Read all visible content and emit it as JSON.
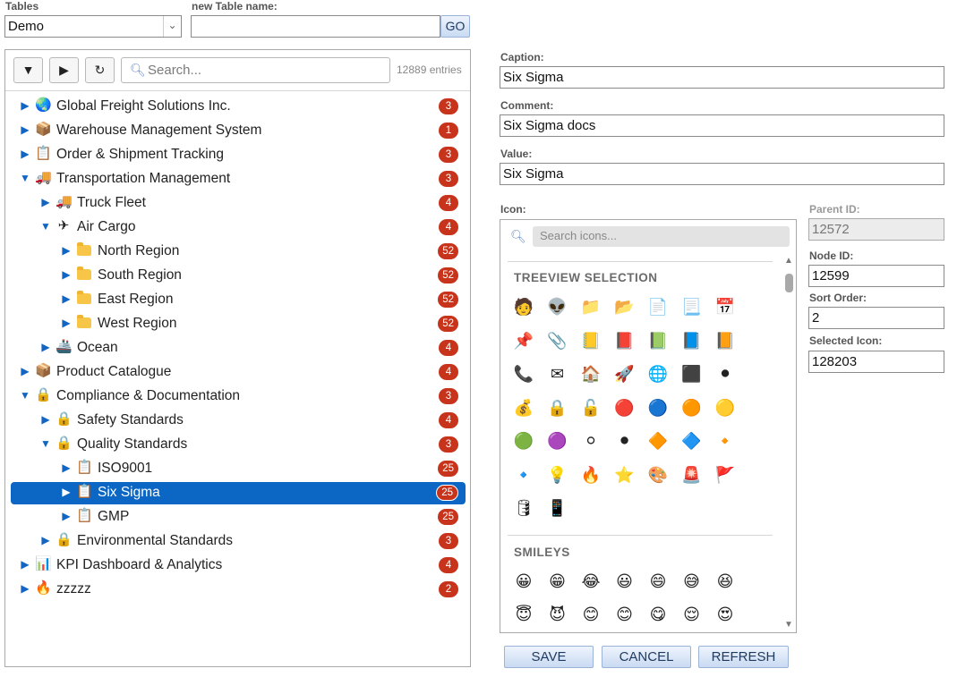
{
  "top": {
    "tables_label": "Tables",
    "tables_value": "Demo",
    "new_table_label": "new Table name:",
    "new_table_value": "",
    "go_label": "GO"
  },
  "tree": {
    "toolbar": {
      "collapse_icon": "▼",
      "expand_icon": "▶",
      "refresh_icon": "↻"
    },
    "search_placeholder": "Search...",
    "entries": "12889 entries",
    "rows": [
      {
        "label": "Global Freight Solutions Inc.",
        "icon": "🌏",
        "count": "3",
        "expanded": false
      },
      {
        "label": "Warehouse Management System",
        "icon": "📦",
        "count": "1",
        "expanded": false
      },
      {
        "label": "Order & Shipment Tracking",
        "icon": "📋",
        "count": "3",
        "expanded": false
      },
      {
        "label": "Transportation Management",
        "icon": "🚚",
        "count": "3",
        "expanded": true
      },
      {
        "label": "Truck Fleet",
        "icon": "🚚",
        "count": "4",
        "expanded": false
      },
      {
        "label": "Air Cargo",
        "icon": "✈",
        "count": "4",
        "expanded": true
      },
      {
        "label": "North Region",
        "icon": "folder",
        "count": "52",
        "expanded": false
      },
      {
        "label": "South Region",
        "icon": "folder",
        "count": "52",
        "expanded": false
      },
      {
        "label": "East Region",
        "icon": "folder",
        "count": "52",
        "expanded": false
      },
      {
        "label": "West Region",
        "icon": "folder",
        "count": "52",
        "expanded": false
      },
      {
        "label": "Ocean",
        "icon": "🚢",
        "count": "4",
        "expanded": false
      },
      {
        "label": "Product Catalogue",
        "icon": "📦",
        "count": "4",
        "expanded": false
      },
      {
        "label": "Compliance & Documentation",
        "icon": "🔒",
        "count": "3",
        "expanded": true
      },
      {
        "label": "Safety Standards",
        "icon": "🔒",
        "count": "4",
        "expanded": false
      },
      {
        "label": "Quality Standards",
        "icon": "🔒",
        "count": "3",
        "expanded": true
      },
      {
        "label": "ISO9001",
        "icon": "📋",
        "count": "25",
        "expanded": false
      },
      {
        "label": "Six Sigma",
        "icon": "📋",
        "count": "25",
        "expanded": false,
        "selected": true
      },
      {
        "label": "GMP",
        "icon": "📋",
        "count": "25",
        "expanded": false
      },
      {
        "label": "Environmental Standards",
        "icon": "🔒",
        "count": "3",
        "expanded": false
      },
      {
        "label": "KPI Dashboard & Analytics",
        "icon": "📊",
        "count": "4",
        "expanded": false
      },
      {
        "label": "zzzzz",
        "icon": "🔥",
        "count": "2",
        "expanded": false
      }
    ]
  },
  "form": {
    "caption_label": "Caption:",
    "caption_value": "Six Sigma",
    "comment_label": "Comment:",
    "comment_value": "Six Sigma docs",
    "value_label": "Value:",
    "value_value": "Six Sigma",
    "icon_label": "Icon:",
    "parent_id_label": "Parent ID:",
    "parent_id_value": "12572",
    "node_id_label": "Node ID:",
    "node_id_value": "12599",
    "sort_order_label": "Sort Order:",
    "sort_order_value": "2",
    "selected_icon_label": "Selected Icon:",
    "selected_icon_value": "128203"
  },
  "icon_picker": {
    "search_placeholder": "Search icons...",
    "sections": [
      {
        "title": "TREEVIEW SELECTION",
        "icons": [
          "🧑",
          "👽",
          "📁",
          "📂",
          "📄",
          "📃",
          "📅",
          "📌",
          "📎",
          "📒",
          "📕",
          "📗",
          "📘",
          "📙",
          "📞",
          "✉",
          "🏠",
          "🚀",
          "🌐",
          "⬛",
          "⚫",
          "💰",
          "🔒",
          "🔓",
          "🔴",
          "🔵",
          "🟠",
          "🟡",
          "🟢",
          "🟣",
          "⚪",
          "⚫",
          "🔶",
          "🔷",
          "🔸",
          "🔹",
          "💡",
          "🔥",
          "⭐",
          "🎨",
          "🚨",
          "🚩",
          "🛢",
          "📱"
        ]
      },
      {
        "title": "SMILEYS",
        "icons": [
          "😀",
          "😁",
          "😂",
          "😃",
          "😄",
          "😅",
          "😆",
          "😇",
          "😈",
          "😊",
          "😊",
          "😋",
          "😌",
          "😍"
        ]
      }
    ]
  },
  "buttons": {
    "save": "SAVE",
    "cancel": "CANCEL",
    "refresh": "REFRESH"
  },
  "colors": {
    "selection": "#0c66c4",
    "badge": "#c7331b",
    "button": "#c9daf2"
  }
}
